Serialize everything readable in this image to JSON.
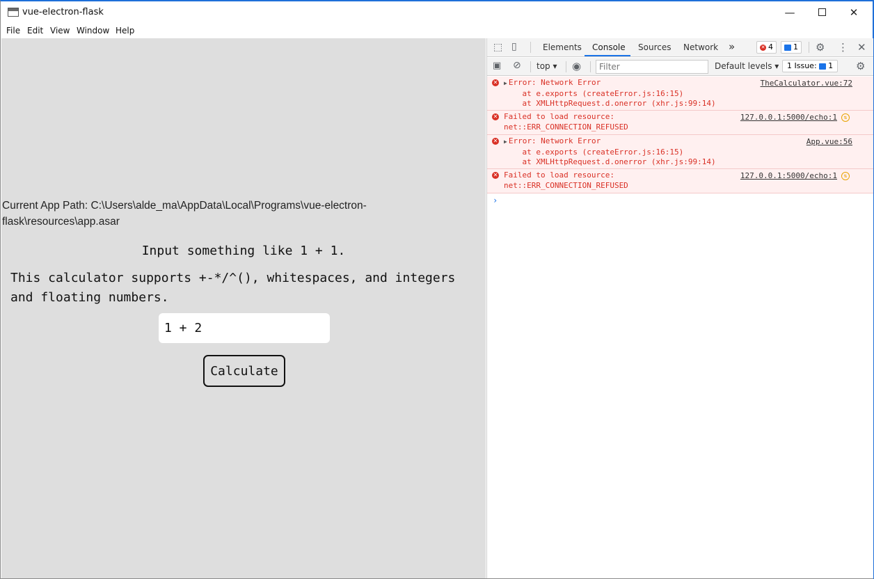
{
  "window": {
    "title": "vue-electron-flask",
    "controls": {
      "minimize": "—",
      "close": "✕"
    }
  },
  "menu": [
    "File",
    "Edit",
    "View",
    "Window",
    "Help"
  ],
  "app": {
    "path_label": "Current App Path: C:\\Users\\alde_ma\\AppData\\Local\\Programs\\vue-electron-flask\\resources\\app.asar",
    "hint1": "Input something like 1 + 1.",
    "hint2": "This calculator supports +-*/^(), whitespaces, and integers and floating numbers.",
    "input_value": "1 + 2",
    "button_label": "Calculate"
  },
  "devtools": {
    "tabs": [
      "Elements",
      "Console",
      "Sources",
      "Network"
    ],
    "active_tab": "Console",
    "more_tabs": "»",
    "error_count": "4",
    "message_count": "1",
    "toolbar": {
      "context": "top ▾",
      "filter_placeholder": "Filter",
      "levels": "Default levels ▾",
      "issues": "1 Issue:",
      "issues_count": "1"
    },
    "entries": [
      {
        "lines": [
          "Error: Network Error",
          "    at e.exports (createError.js:16:15)",
          "    at XMLHttpRequest.d.onerror (xhr.js:99:14)"
        ],
        "source": "TheCalculator.vue:72"
      },
      {
        "lines": [
          "Failed to load resource:",
          "net::ERR_CONNECTION_REFUSED"
        ],
        "source": "127.0.0.1:5000/echo:1"
      },
      {
        "lines": [
          "Error: Network Error",
          "    at e.exports (createError.js:16:15)",
          "    at XMLHttpRequest.d.onerror (xhr.js:99:14)"
        ],
        "source": "App.vue:56"
      },
      {
        "lines": [
          "Failed to load resource:",
          "net::ERR_CONNECTION_REFUSED"
        ],
        "source": "127.0.0.1:5000/echo:1"
      }
    ],
    "prompt": "›"
  }
}
